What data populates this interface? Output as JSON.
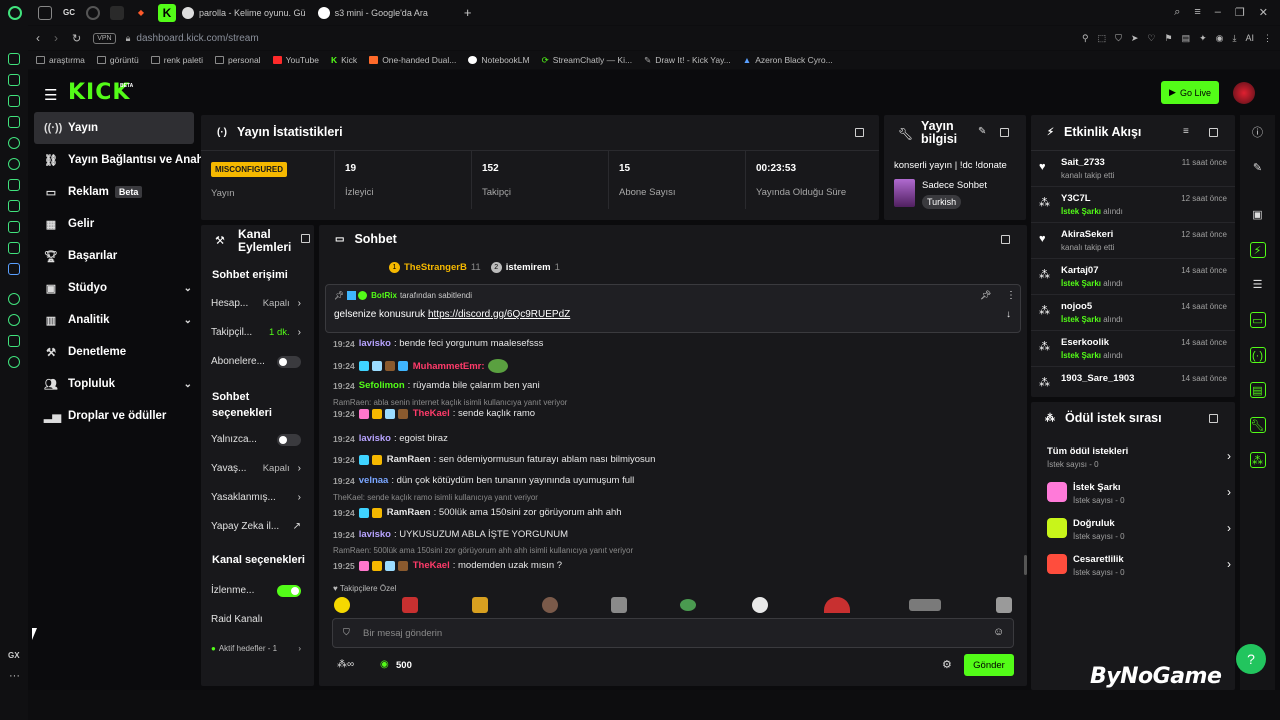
{
  "browser": {
    "tabs": [
      {
        "label": "parolla - Kelime oyunu. Gü"
      },
      {
        "label": "s3 mini - Google'da Ara"
      }
    ],
    "address": "dashboard.kick.com/stream",
    "vpn": "VPN",
    "ai": "AI",
    "bookmarks": [
      "araştırma",
      "görüntü",
      "renk paleti",
      "personal",
      "YouTube",
      "Kick",
      "One-handed Dual...",
      "NotebookLM",
      "StreamChatly — Ki...",
      "Draw It! - Kick Yay...",
      "Azeron Black Cyro..."
    ],
    "gx": "GX"
  },
  "header": {
    "logo": "KICK",
    "beta": "BETA",
    "go_live": "Go Live"
  },
  "sidebar": {
    "items": [
      {
        "label": "Yayın",
        "icon": "broadcast-icon"
      },
      {
        "label": "Yayın Bağlantısı ve Anahtar",
        "icon": "link-icon"
      },
      {
        "label": "Reklam",
        "badge": "Beta",
        "icon": "ad-icon"
      },
      {
        "label": "Gelir",
        "icon": "revenue-icon"
      },
      {
        "label": "Başarılar",
        "icon": "trophy-icon"
      },
      {
        "label": "Stüdyo",
        "icon": "studio-icon"
      },
      {
        "label": "Analitik",
        "icon": "analytics-icon"
      },
      {
        "label": "Denetleme",
        "icon": "hammer-icon"
      },
      {
        "label": "Topluluk",
        "icon": "community-icon"
      },
      {
        "label": "Droplar ve ödüller",
        "icon": "drops-icon"
      }
    ]
  },
  "stats": {
    "title": "Yayın İstatistikleri",
    "status_badge": "MISCONFIGURED",
    "status_label": "Yayın",
    "items": [
      {
        "value": "19",
        "label": "İzleyici"
      },
      {
        "value": "152",
        "label": "Takipçi"
      },
      {
        "value": "15",
        "label": "Abone Sayısı"
      },
      {
        "value": "00:23:53",
        "label": "Yayında Olduğu Süre"
      }
    ]
  },
  "stream_info": {
    "title_line1": "Yayın",
    "title_line2": "bilgisi",
    "stream_title": "konserli yayın | !dc !donate",
    "category": "Sadece Sohbet",
    "language": "Turkish"
  },
  "activity": {
    "title": "Etkinlik Akışı",
    "events": [
      {
        "name": "Sait_2733",
        "desc": "kanalı takip etti",
        "time": "11 saat önce",
        "type": "follow"
      },
      {
        "name": "Y3C7L",
        "highlight": "İstek Şarkı",
        "desc": "alındı",
        "time": "12 saat önce",
        "type": "reward"
      },
      {
        "name": "AkiraSekeri",
        "desc": "kanalı takip etti",
        "time": "12 saat önce",
        "type": "follow"
      },
      {
        "name": "Kartaj07",
        "highlight": "İstek Şarkı",
        "desc": "alındı",
        "time": "14 saat önce",
        "type": "reward"
      },
      {
        "name": "nojoo5",
        "highlight": "İstek Şarkı",
        "desc": "alındı",
        "time": "14 saat önce",
        "type": "reward"
      },
      {
        "name": "Eserkoolik",
        "highlight": "İstek Şarkı",
        "desc": "alındı",
        "time": "14 saat önce",
        "type": "reward"
      },
      {
        "name": "1903_Sare_1903",
        "desc": "",
        "time": "14 saat önce",
        "type": "reward"
      }
    ]
  },
  "rewards": {
    "title": "Ödül istek sırası",
    "items": [
      {
        "name": "Tüm ödül istekleri",
        "sub": "İstek sayısı - 0",
        "color": ""
      },
      {
        "name": "İstek Şarkı",
        "sub": "İstek sayısı - 0",
        "color": "#ff7ad9"
      },
      {
        "name": "Doğruluk",
        "sub": "İstek sayısı - 0",
        "color": "#c8f51a"
      },
      {
        "name": "Cesaretlilik",
        "sub": "İstek sayısı - 0",
        "color": "#ff4d3d"
      }
    ]
  },
  "channel_actions": {
    "title_line1": "Kanal",
    "title_line2": "Eylemleri",
    "chat_access": "Sohbet erişimi",
    "rows1": [
      {
        "label": "Hesap...",
        "value": "Kapalı",
        "ctrl": "chevron"
      },
      {
        "label": "Takipçil...",
        "value": "1 dk.",
        "ctrl": "chevron"
      },
      {
        "label": "Abonelere...",
        "value": "",
        "ctrl": "toggle-off"
      }
    ],
    "chat_options_line1": "Sohbet",
    "chat_options_line2": "seçenekleri",
    "rows2": [
      {
        "label": "Yalnızca...",
        "value": "",
        "ctrl": "toggle-off"
      },
      {
        "label": "Yavaş...",
        "value": "Kapalı",
        "ctrl": "chevron"
      },
      {
        "label": "Yasaklanmış...",
        "value": "",
        "ctrl": "chevron"
      },
      {
        "label": "Yapay Zeka il...",
        "value": "",
        "ctrl": "external"
      }
    ],
    "channel_options": "Kanal seçenekleri",
    "rows3": [
      {
        "label": "İzlenme...",
        "value": "",
        "ctrl": "toggle-on"
      },
      {
        "label": "Raid Kanalı",
        "value": "",
        "ctrl": ""
      }
    ],
    "active_goals": "Aktif hedefler - 1"
  },
  "chat": {
    "title": "Sohbet",
    "top_gifters": [
      {
        "rank": "1",
        "name": "TheStrangerB",
        "count": "11"
      },
      {
        "rank": "2",
        "name": "istemirem",
        "count": "1"
      }
    ],
    "pinned_by": "BotRix",
    "pinned_suffix": "tarafından sabitlendi",
    "pinned_text": "gelsenize konusuruk",
    "pinned_link": "https://discord.gg/6Qc9RUEPdZ",
    "messages": [
      {
        "time": "19:24",
        "user": "lavisko",
        "color": "#b7a3ff",
        "text": "bende feci yorgunum maalesefsss",
        "badges": []
      },
      {
        "time": "19:24",
        "user": "MuhammetEmr:",
        "color": "#ff3b6a",
        "text": "",
        "badges": [
          "#3fd3ff",
          "#9bdcff",
          "#8a5a2e",
          "#3fb6ff"
        ]
      },
      {
        "time": "19:24",
        "user": "Sefolimon",
        "color": "#53fc18",
        "text": "rüyamda bile çalarım ben yani",
        "badges": []
      },
      {
        "time": "19:24",
        "user": "TheKael",
        "color": "#ff3b6a",
        "text": "sende kaçlık ramo",
        "badges": [
          "#ff77cc",
          "#f5b800",
          "#9bdcff",
          "#8a5a2e"
        ]
      },
      {
        "time": "19:24",
        "user": "lavisko",
        "color": "#b7a3ff",
        "text": "egoist biraz",
        "badges": []
      },
      {
        "time": "19:24",
        "user": "RamRaen",
        "color": "#e8e8e8",
        "text": "sen ödemiyormusun faturayı ablam nası bilmiyosun",
        "badges": [
          "#3fd3ff",
          "#f5b800"
        ]
      },
      {
        "time": "19:24",
        "user": "velnaa",
        "color": "#7aa6ff",
        "text": "dün çok kötüydüm ben tunanın yayınında uyumuşum full",
        "badges": []
      },
      {
        "time": "19:24",
        "user": "RamRaen",
        "color": "#e8e8e8",
        "text": "500lük ama 150sini zor görüyorum ahh ahh",
        "badges": [
          "#3fd3ff",
          "#f5b800"
        ]
      },
      {
        "time": "19:24",
        "user": "lavisko",
        "color": "#b7a3ff",
        "text": "UYKUSUZUM ABLA İŞTE YORGUNUM",
        "badges": []
      },
      {
        "time": "19:25",
        "user": "TheKael",
        "color": "#ff3b6a",
        "text": "modemden uzak mısın ?",
        "badges": [
          "#ff77cc",
          "#f5b800",
          "#9bdcff",
          "#8a5a2e"
        ]
      }
    ],
    "replies": [
      "RamRaen: abla senin internet kaçlık isimli kullanıcıya yanıt veriyor",
      "TheKael: sende kaçlık ramo isimli kullanıcıya yanıt veriyor",
      "RamRaen: 500lük ama 150sini zor görüyorum ahh ahh isimli kullanıcıya yanıt veriyor"
    ],
    "followers_only": "Takipçilere Özel",
    "placeholder": "Bir mesaj gönderin",
    "points": "500",
    "send": "Gönder"
  },
  "watermark": "ByNoGame"
}
